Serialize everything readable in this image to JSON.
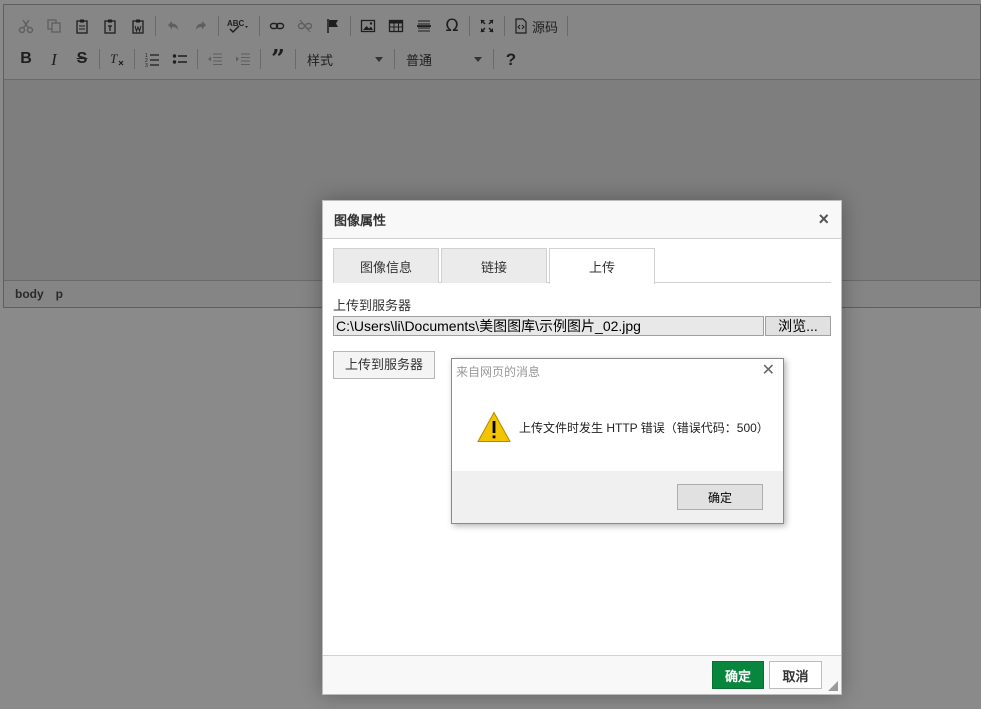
{
  "toolbar": {
    "row1": {
      "source_label": "源码"
    },
    "row2": {
      "styles_combo": "样式",
      "format_combo": "普通"
    }
  },
  "statusbar": {
    "path": [
      "body",
      "p"
    ]
  },
  "image_dialog": {
    "title": "图像属性",
    "close": "×",
    "tabs": [
      "图像信息",
      "链接",
      "上传"
    ],
    "active_tab": "上传",
    "upload_label": "上传到服务器",
    "file_path": "C:\\Users\\li\\Documents\\美图图库\\示例图片_02.jpg",
    "browse_label": "浏览...",
    "upload_button": "上传到服务器",
    "ok_label": "确定",
    "cancel_label": "取消"
  },
  "message_box": {
    "title": "来自网页的消息",
    "close": "✕",
    "message": "上传文件时发生 HTTP 错误（错误代码：500）",
    "ok_label": "确定",
    "icon": "warning-icon"
  },
  "colors": {
    "ok_button": "#09863e",
    "warning": "#f5c400"
  }
}
